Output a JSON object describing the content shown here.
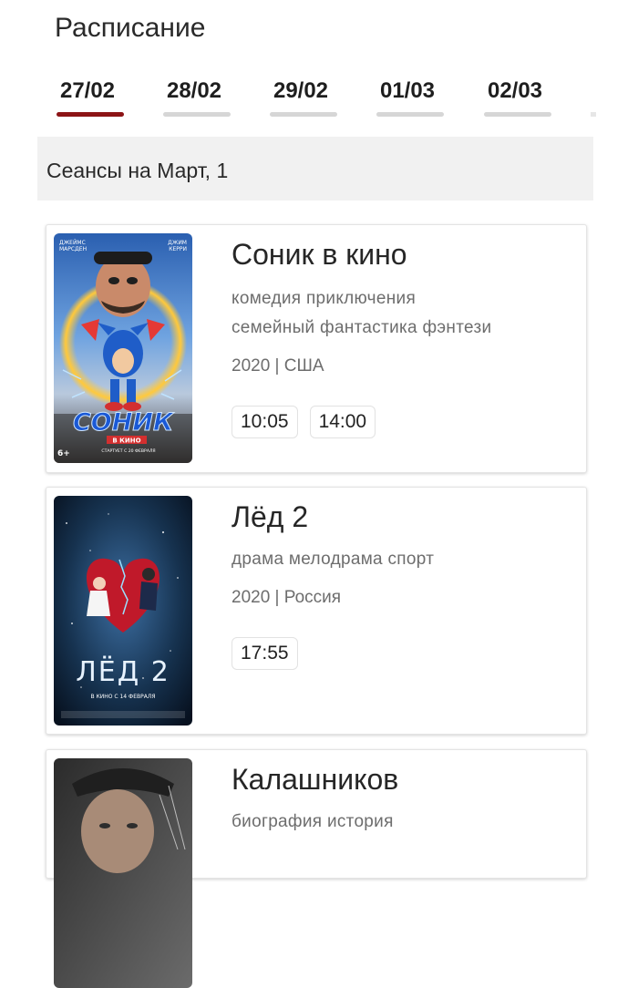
{
  "page": {
    "title": "Расписание"
  },
  "dates": [
    {
      "label": "27/02",
      "active": true
    },
    {
      "label": "28/02",
      "active": false
    },
    {
      "label": "29/02",
      "active": false
    },
    {
      "label": "01/03",
      "active": false
    },
    {
      "label": "02/03",
      "active": false
    }
  ],
  "section": {
    "heading": "Сеансы на Март, 1"
  },
  "movies": [
    {
      "title": "Соник в кино",
      "genres": [
        "комедия приключения",
        "семейный фантастика фэнтези"
      ],
      "meta": "2020 | США",
      "times": [
        "10:05",
        "14:00"
      ],
      "poster": {
        "top_left": "ДЖЕЙМС\nМАРСДЕН",
        "top_right": "ДЖИМ\nКЕРРИ",
        "logo": "СОНИК",
        "sub": "В КИНО",
        "age": "6+",
        "release": "СТАРТУЕТ С 20 ФЕВРАЛЯ"
      }
    },
    {
      "title": "Лёд 2",
      "genres": [
        "драма мелодрама спорт"
      ],
      "meta": "2020 | Россия",
      "times": [
        "17:55"
      ],
      "poster": {
        "logo": "ЛЁД 2",
        "release": "В КИНО С 14 ФЕВРАЛЯ"
      }
    },
    {
      "title": "Калашников",
      "genres": [
        "биография история"
      ],
      "meta": "",
      "times": [],
      "poster": {}
    }
  ],
  "colors": {
    "accent": "#8c1416",
    "tab_inactive": "#d6d6d6",
    "band": "#f1f1f1"
  }
}
